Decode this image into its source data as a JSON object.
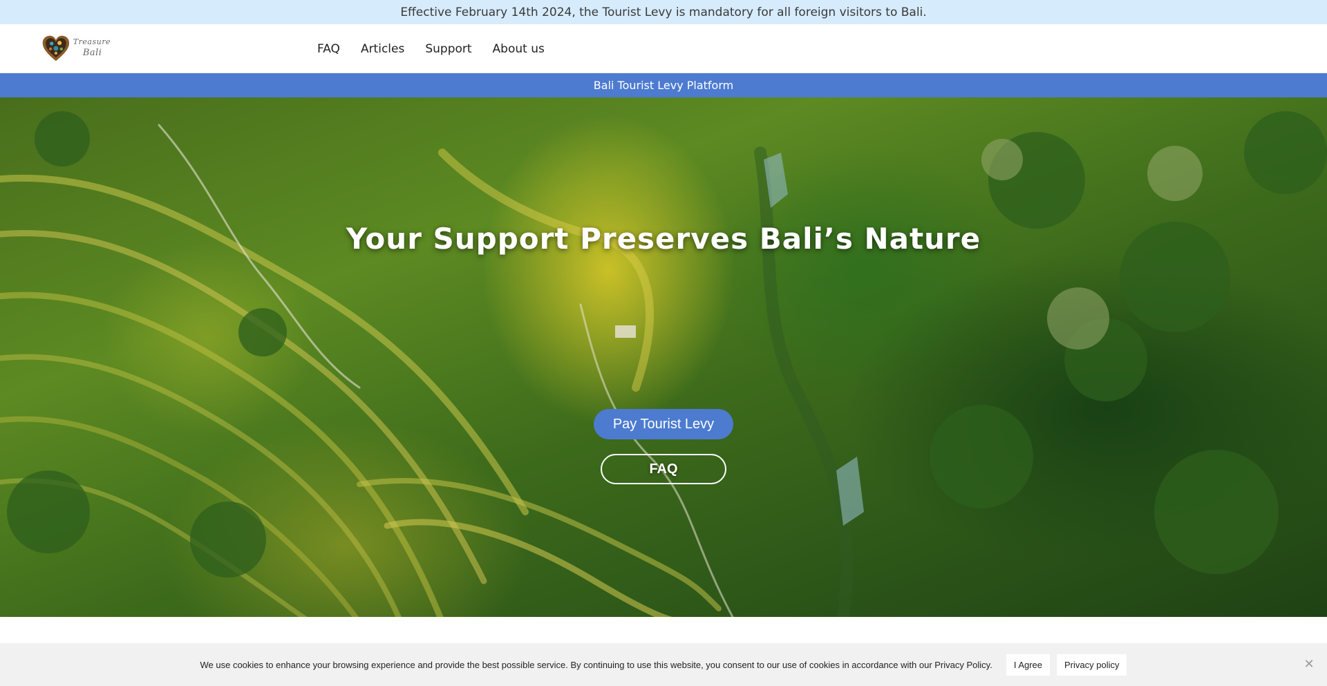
{
  "announcement": {
    "text": "Effective February 14th 2024, the Tourist Levy is mandatory for all foreign visitors to Bali."
  },
  "header": {
    "logo_line1": "Treasure",
    "logo_line2": "Bali",
    "nav": [
      "FAQ",
      "Articles",
      "Support",
      "About us"
    ]
  },
  "platform_bar": {
    "text": "Bali Tourist Levy Platform"
  },
  "hero": {
    "title": "Your Support Preserves Bali’s Nature",
    "primary_button": "Pay Tourist Levy",
    "secondary_button": "FAQ"
  },
  "cookie": {
    "text": "We use cookies to enhance your browsing experience and provide the best possible service. By continuing to use this website, you consent to our use of cookies in accordance with our Privacy Policy.",
    "agree": "I Agree",
    "policy": "Privacy policy",
    "close_icon": "close-icon"
  },
  "colors": {
    "announcement_bg": "#d6ebfb",
    "accent": "#4c7bd0",
    "cookie_bg": "#f1f1f1"
  }
}
